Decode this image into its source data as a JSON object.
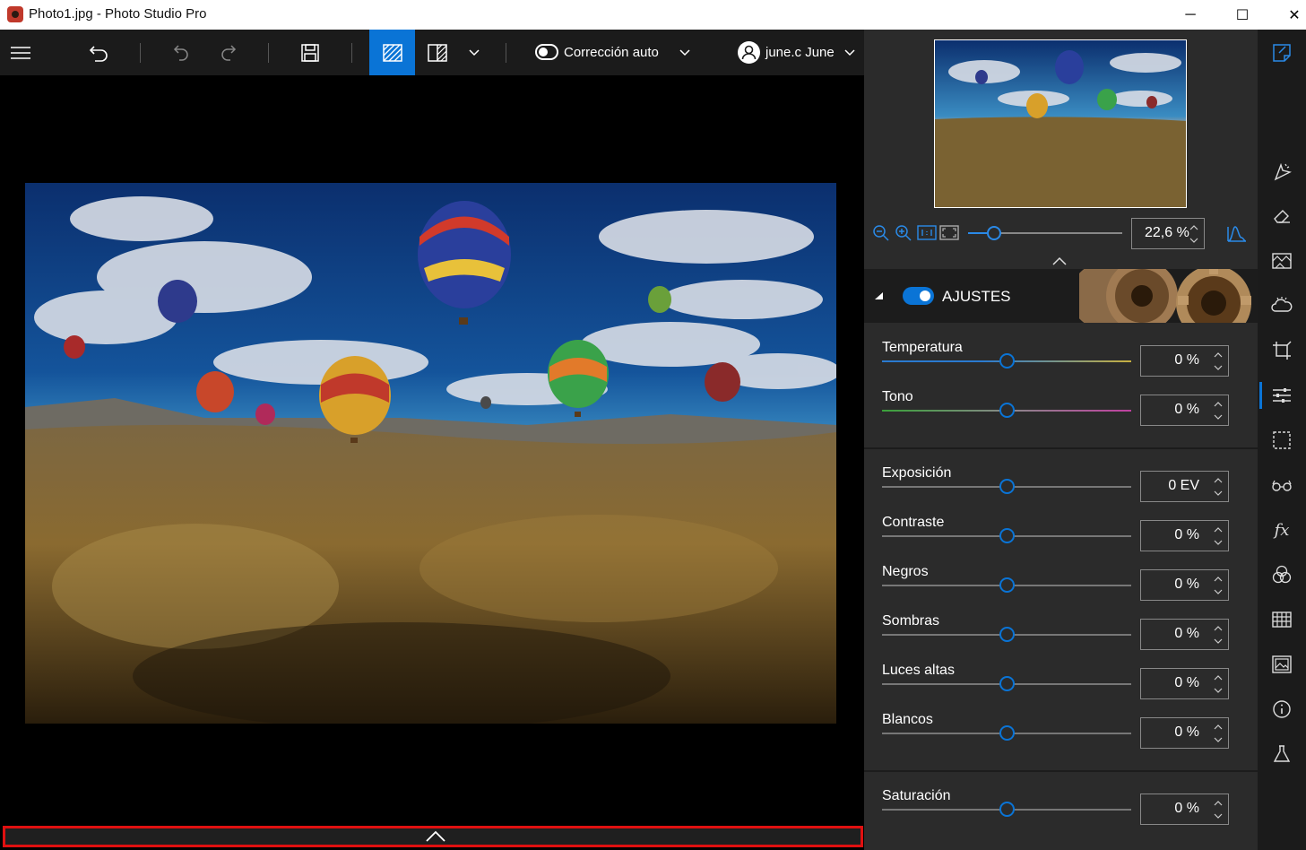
{
  "window": {
    "title": "Photo1.jpg - Photo Studio Pro",
    "minimize": "─",
    "maximize": "☐",
    "close": "✕"
  },
  "toolbar": {
    "auto_correction_label": "Corrección auto",
    "user_name": "june.c June",
    "icons": [
      "menu-icon",
      "revert-icon",
      "undo-icon",
      "redo-icon",
      "save-icon",
      "single-view-icon",
      "compare-view-icon",
      "chevron-down-icon",
      "chevron-down-icon",
      "chevron-down-icon"
    ]
  },
  "navigator": {
    "zoom_value": "22,6 %",
    "zoom_level_fraction": 0.17,
    "icons": [
      "zoom-out-icon",
      "zoom-in-icon",
      "actual-size-icon",
      "fit-screen-icon",
      "histogram-icon"
    ]
  },
  "adjustments": {
    "section_title": "AJUSTES",
    "enabled": true,
    "groups": [
      [
        {
          "label": "Temperatura",
          "value": "0 %",
          "level": 0.5
        },
        {
          "label": "Tono",
          "value": "0 %",
          "level": 0.5
        }
      ],
      [
        {
          "label": "Exposición",
          "value": "0 EV",
          "level": 0.5
        },
        {
          "label": "Contraste",
          "value": "0 %",
          "level": 0.5
        },
        {
          "label": "Negros",
          "value": "0 %",
          "level": 0.5
        },
        {
          "label": "Sombras",
          "value": "0 %",
          "level": 0.5
        },
        {
          "label": "Luces altas",
          "value": "0 %",
          "level": 0.5
        },
        {
          "label": "Blancos",
          "value": "0 %",
          "level": 0.5
        }
      ],
      [
        {
          "label": "Saturación",
          "value": "0 %",
          "level": 0.5
        }
      ]
    ]
  },
  "tools": [
    "notes-icon",
    "auto-fix-icon",
    "eraser-icon",
    "texture-icon",
    "clouds-icon",
    "crop-icon",
    "adjustments-icon",
    "selection-icon",
    "red-eye-icon",
    "effects-fx-icon",
    "color-mix-icon",
    "grid-icon",
    "image-frame-icon",
    "info-icon",
    "lab-flask-icon"
  ],
  "colors": {
    "accent": "#0a74d6",
    "panel": "#2b2b2b",
    "toolbar": "#1b1b1b",
    "highlight_border": "#e01010"
  }
}
